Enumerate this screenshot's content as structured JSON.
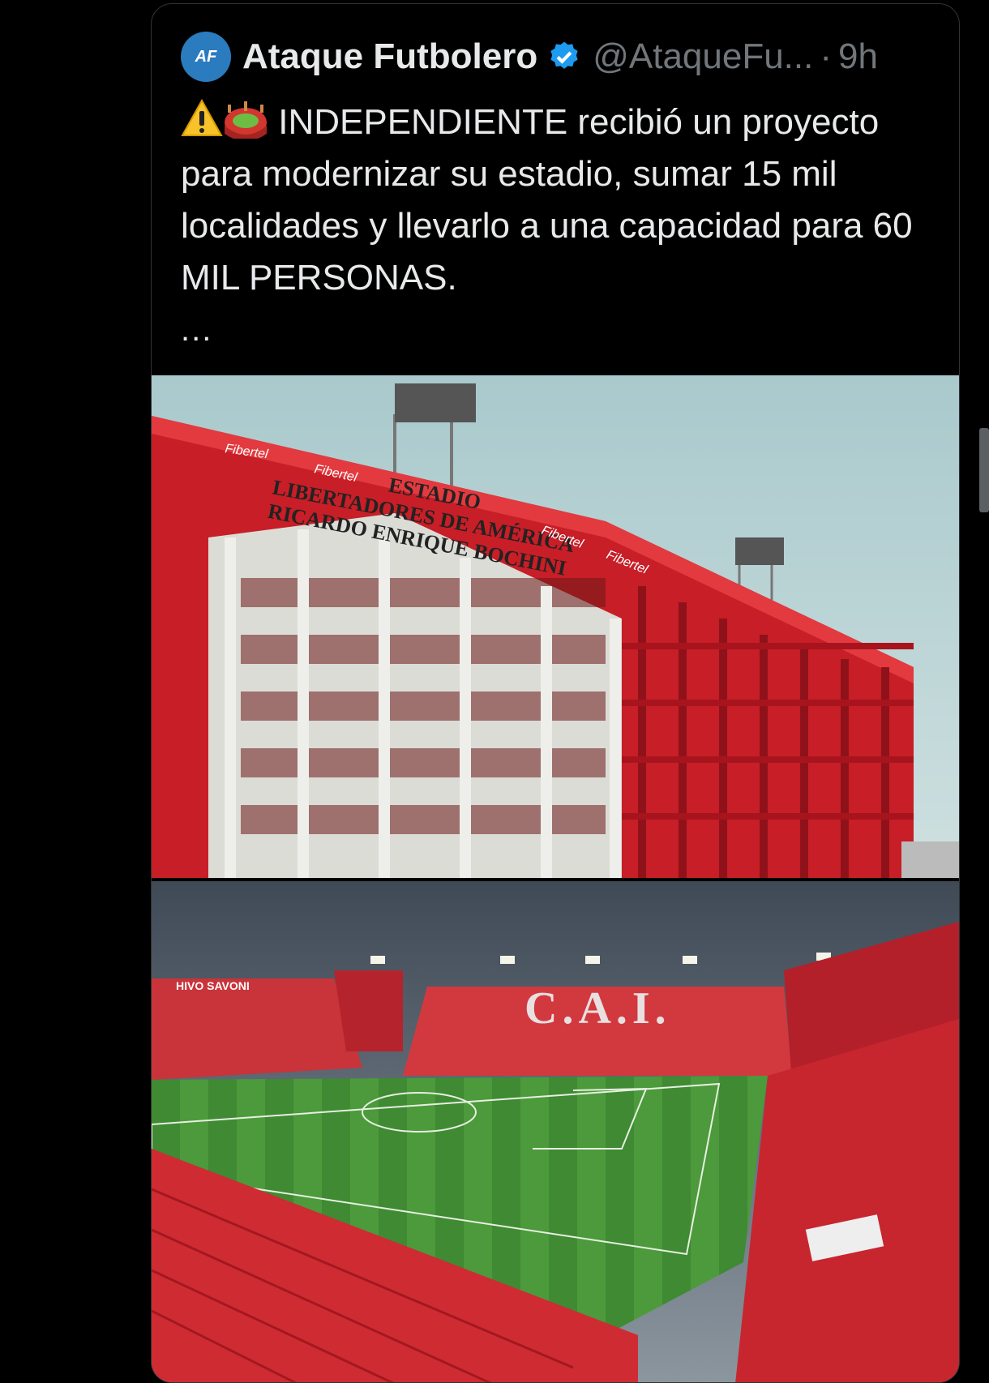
{
  "tweet": {
    "author_name": "Ataque Futbolero",
    "avatar_text": "AF",
    "handle": "@AtaqueFu...",
    "separator": "·",
    "time": "9h",
    "text": "INDEPENDIENTE recibió un proyecto para modernizar su estadio, sumar 15 mil localidades y llevarlo a una capacidad para 60 MIL PERSONAS.",
    "ellipsis": "...",
    "emoji": [
      "warning-icon",
      "stadium-icon"
    ]
  },
  "images": {
    "first": {
      "sign_line1": "ESTADIO",
      "sign_line2": "LIBERTADORES DE AMÉRICA",
      "sign_line3": "RICARDO ENRIQUE BOCHINI",
      "sponsor": "Fibertel"
    },
    "second": {
      "stand_text": "C.A.I.",
      "banner_text": "HIVO SAVONI"
    }
  },
  "colors": {
    "verified": "#1d9bf0",
    "stadium_red": "#d81e2a",
    "pitch_green": "#3f8a32"
  }
}
